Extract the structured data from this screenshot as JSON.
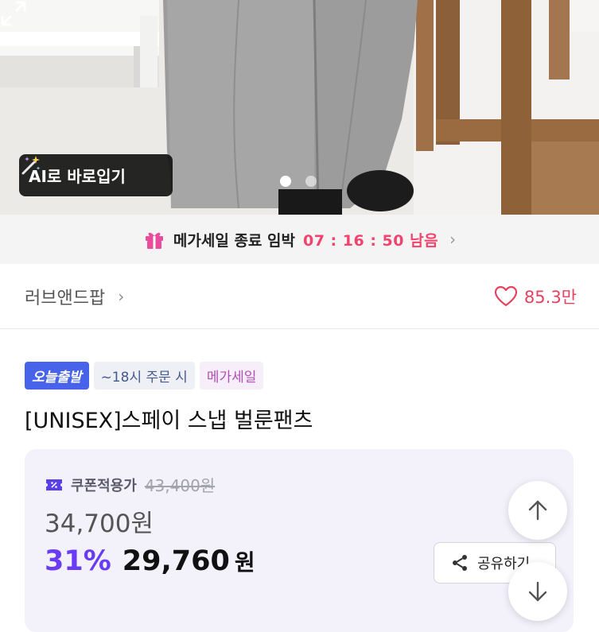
{
  "hero": {
    "ai_button_label": "AI로 바로입기",
    "carousel_total": 2,
    "carousel_active": 1
  },
  "sale_strip": {
    "label": "메가세일 종료 임박",
    "timer": "07 : 16 : 50 남음"
  },
  "brand": {
    "name": "러브앤드팝",
    "likes": "85.3만"
  },
  "badges": {
    "today": "오늘출발",
    "order_cutoff": "~18시 주문 시",
    "mega": "메가세일"
  },
  "product": {
    "title": "[UNISEX]스페이 스냅 벌룬팬츠"
  },
  "price": {
    "coupon_label": "쿠폰적용가",
    "original": "43,400원",
    "sale_price": "34,700원",
    "discount_pct": "31%",
    "final_price": "29,760",
    "currency": "원"
  },
  "actions": {
    "share_label": "공유하기"
  },
  "colors": {
    "accent_pink": "#f0436e",
    "accent_purple": "#6a3bf5",
    "badge_blue": "#4763e9"
  },
  "icons": [
    "magic-wand-icon",
    "expand-icon",
    "gift-icon",
    "chevron-right-icon",
    "heart-icon",
    "coupon-icon",
    "share-icon",
    "arrow-up-icon",
    "arrow-down-icon"
  ]
}
